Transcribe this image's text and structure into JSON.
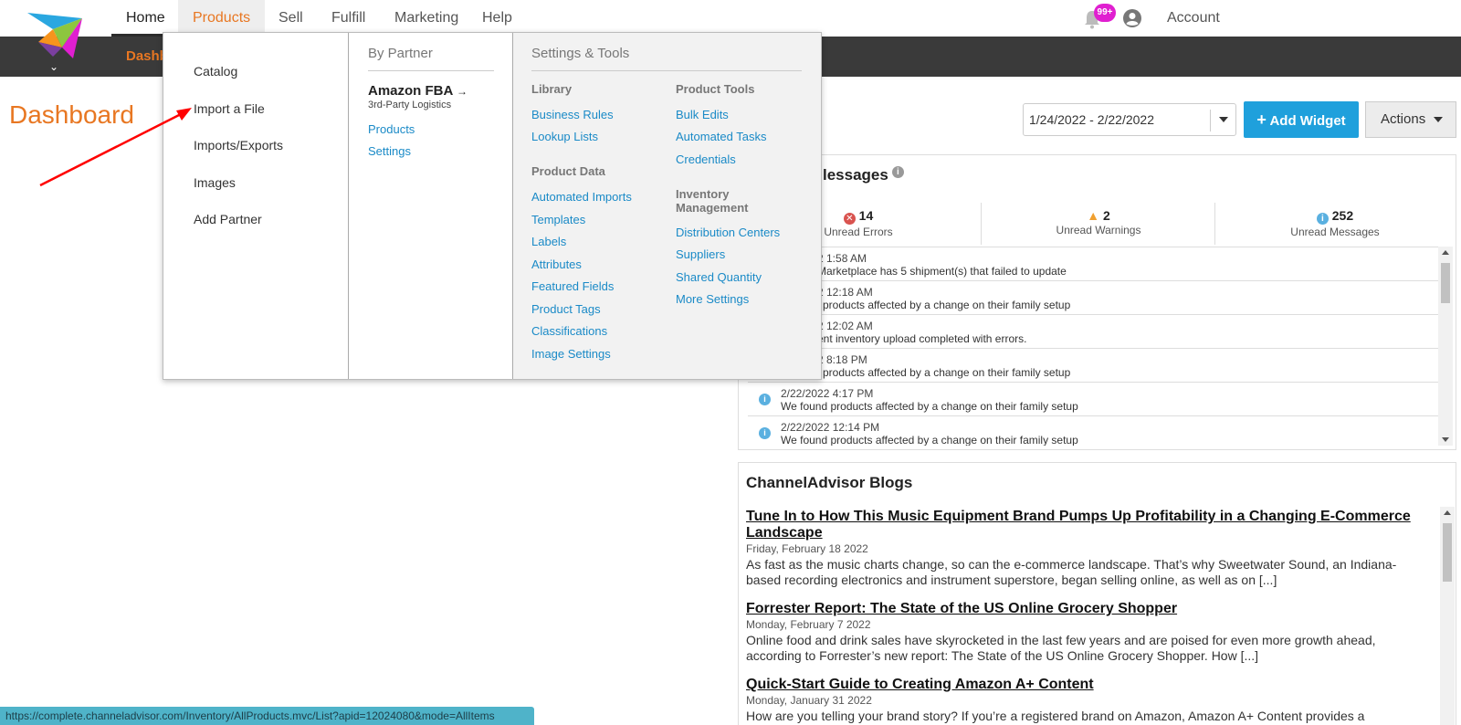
{
  "nav": {
    "home": "Home",
    "products": "Products",
    "sell": "Sell",
    "fulfill": "Fulfill",
    "marketing": "Marketing",
    "help": "Help",
    "notifications_badge": "99+",
    "account": "Account"
  },
  "subbar": {
    "active_tab": "Dashb"
  },
  "page": {
    "title": "Dashboard"
  },
  "toolbar": {
    "date_range": "1/24/2022 - 2/22/2022",
    "add_widget": "Add Widget",
    "add_widget_icon": "+",
    "actions": "Actions"
  },
  "menu": {
    "col1": [
      "Catalog",
      "Import a File",
      "Imports/Exports",
      "Images",
      "Add Partner"
    ],
    "by_partner": {
      "header": "By Partner",
      "partner_name": "Amazon FBA",
      "partner_sub": "3rd-Party Logistics",
      "links": [
        "Products",
        "Settings"
      ]
    },
    "settings_tools": {
      "header": "Settings & Tools",
      "library_header": "Library",
      "library": [
        "Business Rules",
        "Lookup Lists"
      ],
      "product_data_header": "Product Data",
      "product_data": [
        "Automated Imports",
        "Templates",
        "Labels",
        "Attributes",
        "Featured Fields",
        "Product Tags",
        "Classifications",
        "Image Settings"
      ],
      "product_tools_header": "Product Tools",
      "product_tools": [
        "Bulk Edits",
        "Automated Tasks",
        "Credentials"
      ],
      "inventory_header_1": "Inventory",
      "inventory_header_2": "Management",
      "inventory": [
        "Distribution Centers",
        "Suppliers",
        "Shared Quantity",
        "More Settings"
      ]
    }
  },
  "messages": {
    "title": "lessages",
    "errors_count": "14",
    "errors_label": "Unread Errors",
    "warnings_count": "2",
    "warnings_label": "Unread Warnings",
    "messages_count": "252",
    "messages_label": "Unread Messages",
    "rows": [
      {
        "time": "2 1:58 AM",
        "text": "Marketplace has 5 shipment(s) that failed to update"
      },
      {
        "time": "2 12:18 AM",
        "text": "l products affected by a change on their family setup"
      },
      {
        "time": "2 12:02 AM",
        "text": "ent inventory upload completed with errors."
      },
      {
        "time": "2 8:18 PM",
        "text": "l products affected by a change on their family setup"
      },
      {
        "time": "2/22/2022 4:17 PM",
        "text": "We found products affected by a change on their family setup"
      },
      {
        "time": "2/22/2022 12:14 PM",
        "text": "We found products affected by a change on their family setup"
      }
    ]
  },
  "blogs": {
    "title": "ChannelAdvisor Blogs",
    "items": [
      {
        "title": "Tune In to How This Music Equipment Brand Pumps Up Profitability in a Changing E-Commerce Landscape",
        "date": "Friday, February 18 2022",
        "body": "As fast as the music charts change, so can the e-commerce landscape. That’s why Sweetwater Sound, an Indiana-based recording electronics and instrument superstore, began selling online, as well as on [...]"
      },
      {
        "title": "Forrester Report: The State of the US Online Grocery Shopper",
        "date": "Monday, February 7 2022",
        "body": "Online food and drink sales have skyrocketed in the last few years and are poised for even more growth ahead, according to Forrester’s new report: The State of the US Online Grocery Shopper. How [...]"
      },
      {
        "title": "Quick-Start Guide to Creating Amazon A+ Content",
        "date": "Monday, January 31 2022",
        "body": "How are you telling your brand story? If you’re a registered brand on Amazon, Amazon A+ Content provides a"
      }
    ]
  },
  "status_url": "https://complete.channeladvisor.com/Inventory/AllProducts.mvc/List?apid=12024080&mode=AllItems",
  "colors": {
    "accent": "#e87722",
    "link": "#1a8ac7",
    "primary_button": "#1fa0dc"
  }
}
